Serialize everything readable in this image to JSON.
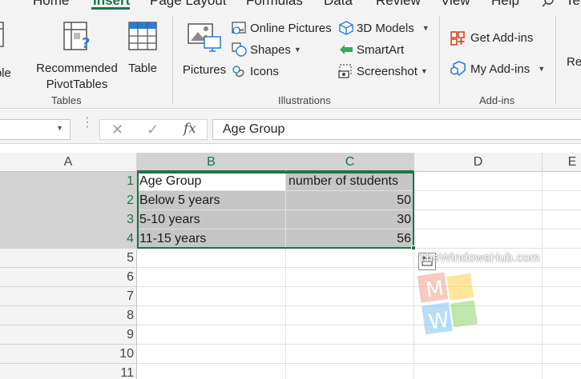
{
  "ribbon_tabs": [
    "Home",
    "Insert",
    "Page Layout",
    "Formulas",
    "Data",
    "Review",
    "View",
    "Help",
    "Te"
  ],
  "active_tab": "Insert",
  "ribbon": {
    "tables": {
      "label": "Tables",
      "pivot_label": "Table",
      "recommended_line1": "Recommended",
      "recommended_line2": "PivotTables",
      "table_label": "Table"
    },
    "illustrations": {
      "label": "Illustrations",
      "pictures": "Pictures",
      "online_pictures": "Online Pictures",
      "shapes": "Shapes",
      "icons": "Icons",
      "models_3d": "3D Models",
      "smartart": "SmartArt",
      "screenshot": "Screenshot"
    },
    "addins": {
      "label": "Add-ins",
      "get_addins": "Get Add-ins",
      "my_addins": "My Add-ins"
    },
    "next_group_partial": "Re"
  },
  "formula_bar": {
    "value": "Age Group",
    "fx": "fx"
  },
  "grid": {
    "columns": [
      "A",
      "B",
      "C",
      "D",
      "E"
    ],
    "selected_columns": [
      "B",
      "C"
    ],
    "rows": [
      "1",
      "2",
      "3",
      "4",
      "5",
      "6",
      "7",
      "8",
      "9",
      "10",
      "11"
    ],
    "data": [
      [
        "Age Group",
        "number of students"
      ],
      [
        "Below 5 years",
        "50"
      ],
      [
        "5-10 years",
        "30"
      ],
      [
        "11-15 years",
        "56"
      ]
    ]
  },
  "watermark": {
    "text": "TheWindowsHub.com",
    "letters": [
      "M",
      "W"
    ]
  },
  "colors": {
    "excel_green": "#217346",
    "ribbon_bg": "#f3f3f3",
    "selection_shade": "#c6c6c6"
  }
}
